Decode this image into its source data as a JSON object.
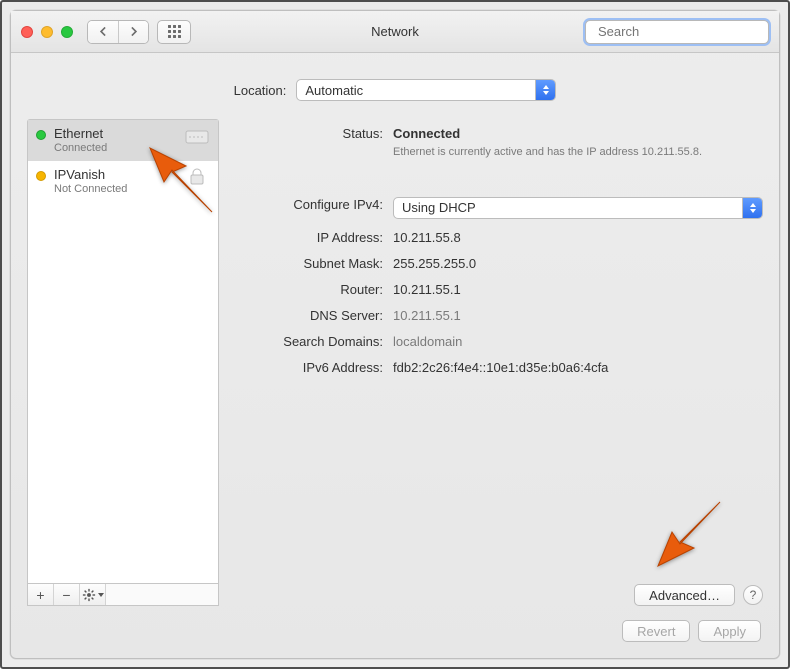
{
  "window": {
    "title": "Network",
    "search_placeholder": "Search"
  },
  "location": {
    "label": "Location:",
    "value": "Automatic"
  },
  "sidebar": {
    "services": [
      {
        "name": "Ethernet",
        "sub": "Connected",
        "status": "green",
        "selected": true,
        "icon": "ethernet"
      },
      {
        "name": "IPVanish",
        "sub": "Not Connected",
        "status": "orange",
        "selected": false,
        "icon": "lock"
      }
    ],
    "footer": {
      "add": "+",
      "remove": "−",
      "actions": "✻"
    }
  },
  "detail": {
    "status_label": "Status:",
    "status_value": "Connected",
    "status_note": "Ethernet is currently active and has the IP address 10.211.55.8.",
    "configure_label": "Configure IPv4:",
    "configure_value": "Using DHCP",
    "fields": [
      {
        "label": "IP Address:",
        "value": "10.211.55.8",
        "dim": false
      },
      {
        "label": "Subnet Mask:",
        "value": "255.255.255.0",
        "dim": false
      },
      {
        "label": "Router:",
        "value": "10.211.55.1",
        "dim": false
      },
      {
        "label": "DNS Server:",
        "value": "10.211.55.1",
        "dim": true
      },
      {
        "label": "Search Domains:",
        "value": "localdomain",
        "dim": true
      },
      {
        "label": "IPv6 Address:",
        "value": "fdb2:2c26:f4e4::10e1:d35e:b0a6:4cfa",
        "dim": false
      }
    ],
    "advanced": "Advanced…",
    "help": "?"
  },
  "buttons": {
    "revert": "Revert",
    "apply": "Apply"
  }
}
